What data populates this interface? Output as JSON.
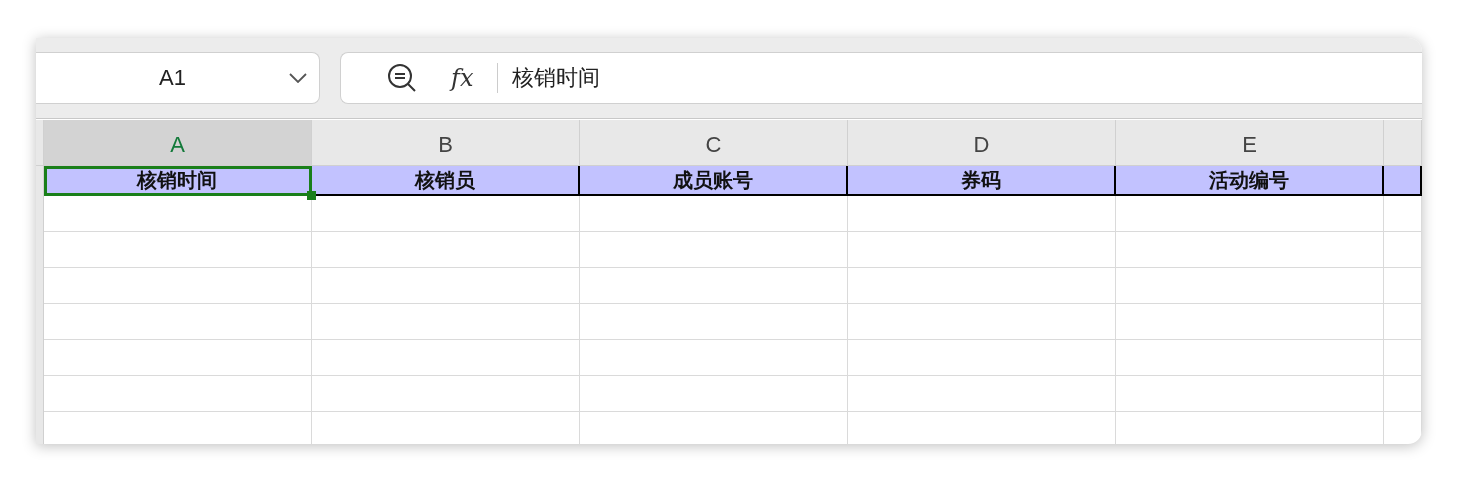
{
  "name_box": {
    "value": "A1"
  },
  "formula_bar": {
    "fx": "fx",
    "value": "核销时间"
  },
  "columns": [
    {
      "label": "A",
      "selected": true
    },
    {
      "label": "B",
      "selected": false
    },
    {
      "label": "C",
      "selected": false
    },
    {
      "label": "D",
      "selected": false
    },
    {
      "label": "E",
      "selected": false
    }
  ],
  "header_row": [
    {
      "text": "核销时间",
      "selected": true
    },
    {
      "text": "核销员",
      "selected": false
    },
    {
      "text": "成员账号",
      "selected": false
    },
    {
      "text": "券码",
      "selected": false
    },
    {
      "text": "活动编号",
      "selected": false
    }
  ]
}
